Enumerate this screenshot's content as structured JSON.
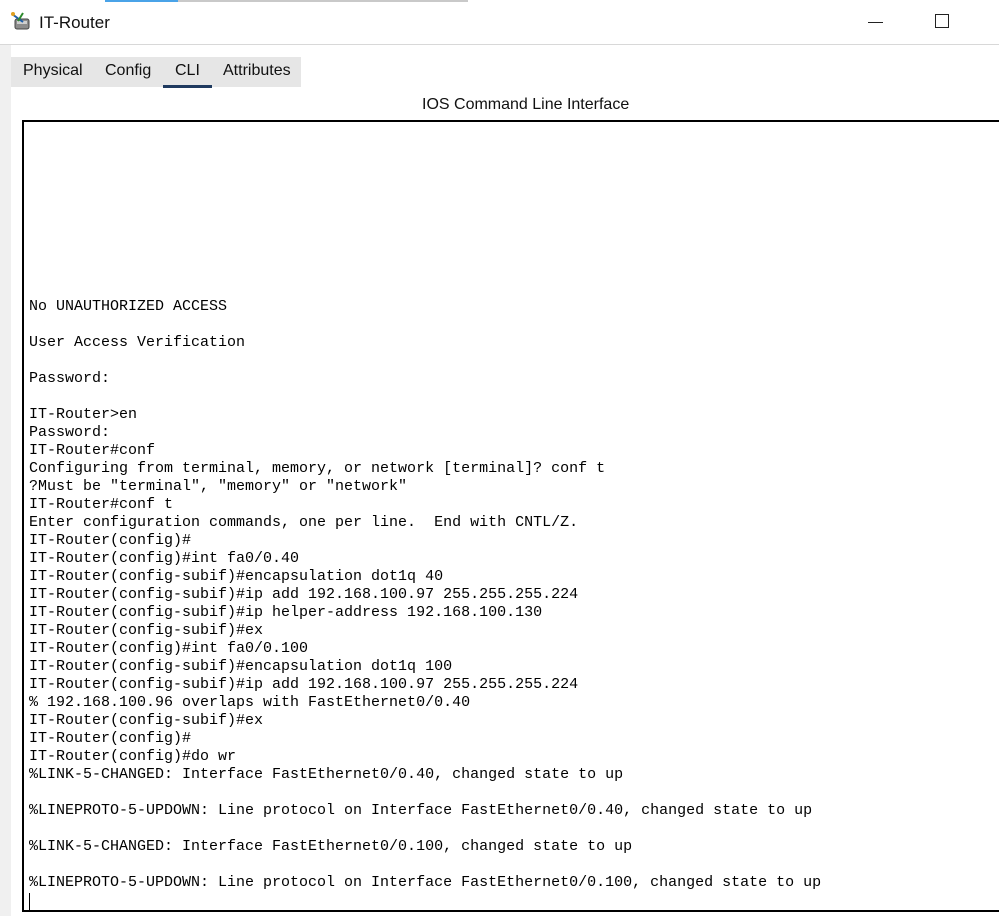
{
  "window": {
    "title": "IT-Router",
    "icon": "router-device-icon"
  },
  "tabs": [
    {
      "label": "Physical",
      "active": false
    },
    {
      "label": "Config",
      "active": false
    },
    {
      "label": "CLI",
      "active": true
    },
    {
      "label": "Attributes",
      "active": false
    }
  ],
  "cli": {
    "heading": "IOS Command Line Interface",
    "lines": [
      "No UNAUTHORIZED ACCESS",
      "",
      "User Access Verification",
      "",
      "Password:",
      "",
      "IT-Router>en",
      "Password:",
      "IT-Router#conf",
      "Configuring from terminal, memory, or network [terminal]? conf t",
      "?Must be \"terminal\", \"memory\" or \"network\"",
      "IT-Router#conf t",
      "Enter configuration commands, one per line.  End with CNTL/Z.",
      "IT-Router(config)#",
      "IT-Router(config)#int fa0/0.40",
      "IT-Router(config-subif)#encapsulation dot1q 40",
      "IT-Router(config-subif)#ip add 192.168.100.97 255.255.255.224",
      "IT-Router(config-subif)#ip helper-address 192.168.100.130",
      "IT-Router(config-subif)#ex",
      "IT-Router(config)#int fa0/0.100",
      "IT-Router(config-subif)#encapsulation dot1q 100",
      "IT-Router(config-subif)#ip add 192.168.100.97 255.255.255.224",
      "% 192.168.100.96 overlaps with FastEthernet0/0.40",
      "IT-Router(config-subif)#ex",
      "IT-Router(config)#",
      "IT-Router(config)#do wr",
      "%LINK-5-CHANGED: Interface FastEthernet0/0.40, changed state to up",
      "",
      "%LINEPROTO-5-UPDOWN: Line protocol on Interface FastEthernet0/0.40, changed state to up",
      "",
      "%LINK-5-CHANGED: Interface FastEthernet0/0.100, changed state to up",
      "",
      "%LINEPROTO-5-UPDOWN: Line protocol on Interface FastEthernet0/0.100, changed state to up"
    ]
  }
}
